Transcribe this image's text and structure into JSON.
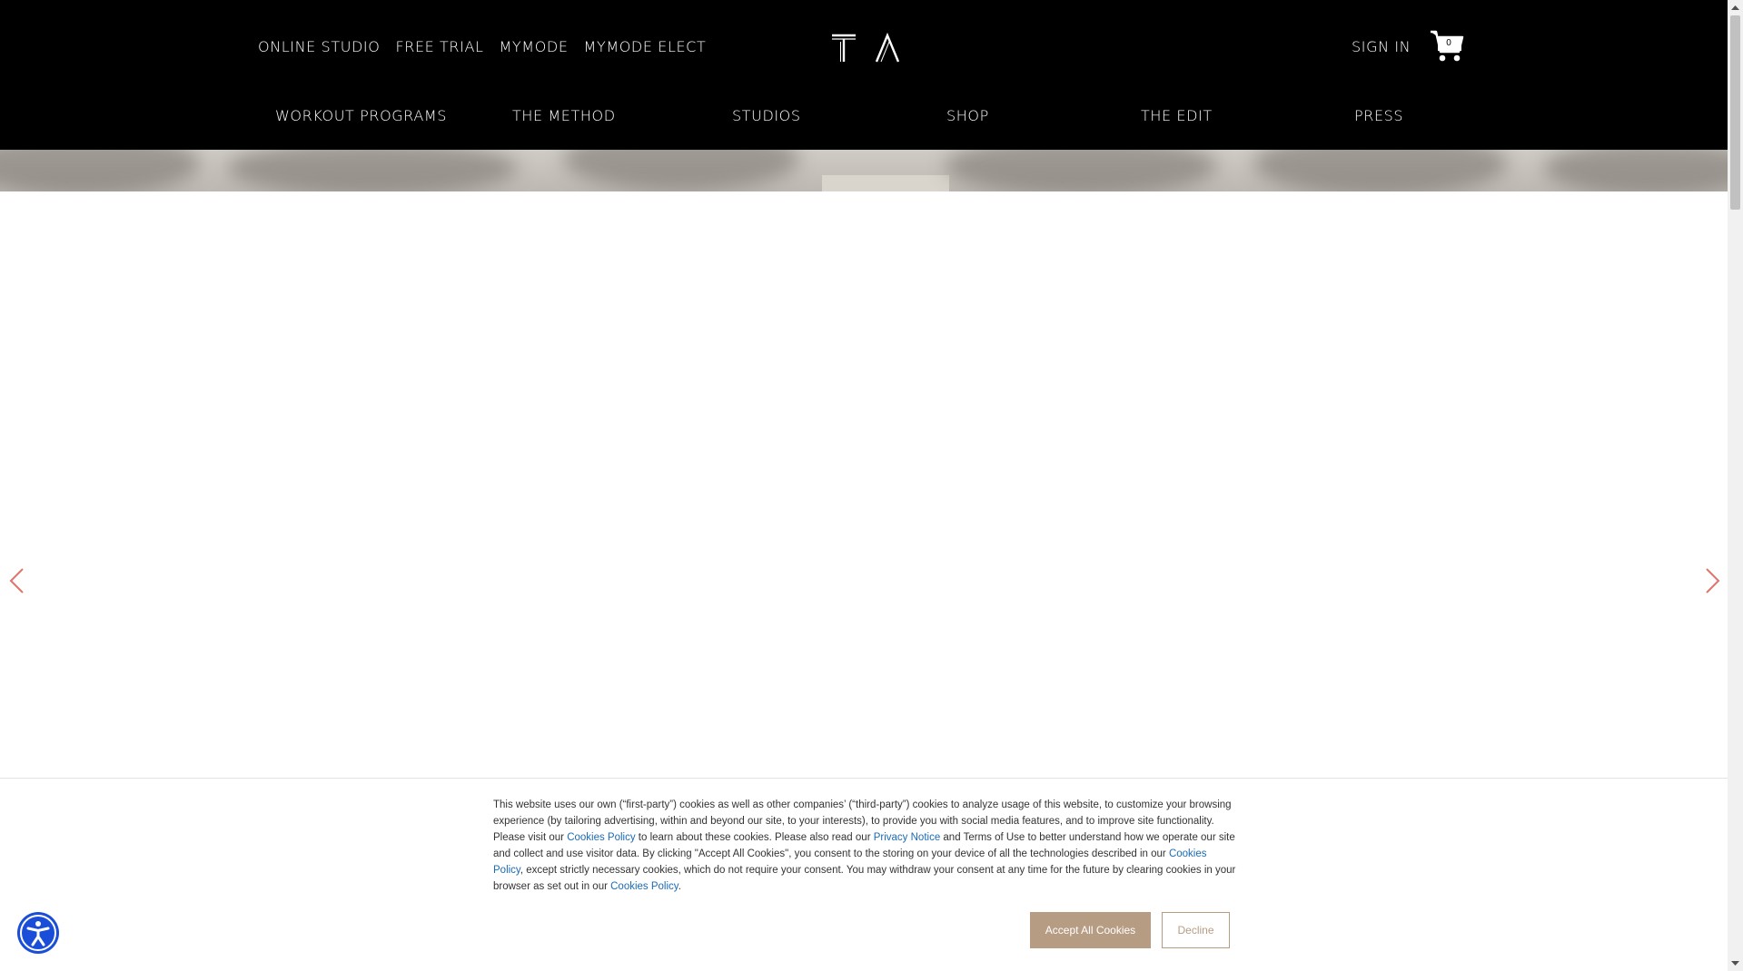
{
  "header": {
    "utility_links": [
      "ONLINE STUDIO",
      "FREE TRIAL",
      "MYMODE",
      "MYMODE ELECT"
    ],
    "logo_letters": "T A",
    "sign_in": "SIGN IN",
    "cart_count": "0",
    "cart_icon": "cart-icon",
    "main_nav": [
      "WORKOUT PROGRAMS",
      "THE METHOD",
      "STUDIOS",
      "SHOP",
      "THE EDIT",
      "PRESS"
    ]
  },
  "carousel": {
    "prev_icon": "chevron-left-icon",
    "next_icon": "chevron-right-icon",
    "arrow_color": "#e0736b"
  },
  "cookie_banner": {
    "p1": "This website uses our own (“first-party”) cookies as well as other companies’ (“third-party”) cookies to analyze usage of this website, to customize your browsing experience (by tailoring advertising, within and beyond our site, to your interests), to provide you with social media features, and to improve site functionality. Please visit our ",
    "link1": "Cookies Policy",
    "p2": " to learn about these cookies. Please also read our ",
    "link2": "Privacy Notice",
    "p3": " and Terms of Use to better understand how we operate our site and collect and use visitor data. By clicking \"Accept All Cookies\", you consent to the storing on your device of all the technologies described in our ",
    "link3": "Cookies Policy",
    "p4": ", except strictly necessary cookies, which do not require your consent. You may withdraw your consent at any time for the future by clearing cookies in your browser as set out in our ",
    "link4": "Cookies Policy",
    "p5": ".",
    "accept_label": "Accept All Cookies",
    "decline_label": "Decline",
    "accent_color": "#b79c84",
    "link_color": "#1b6bb5"
  },
  "accessibility": {
    "icon": "accessibility-icon",
    "color": "#1a4ed8"
  }
}
